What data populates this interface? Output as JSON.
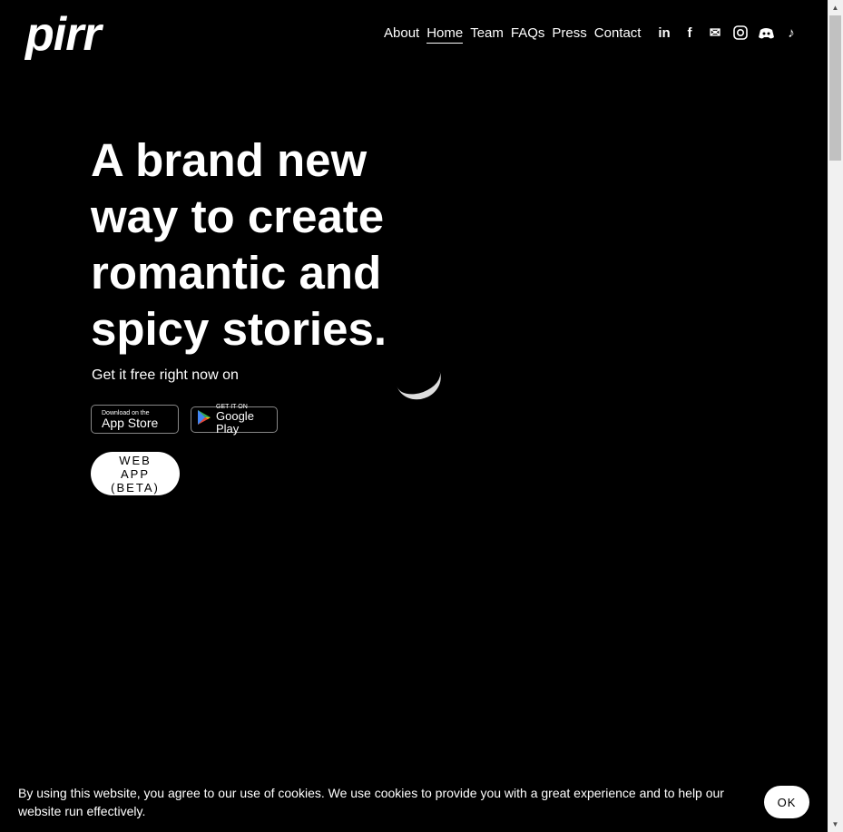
{
  "logo": "pirr",
  "nav": [
    "About",
    "Home",
    "Team",
    "FAQs",
    "Press",
    "Contact"
  ],
  "active_nav": "Home",
  "social": [
    "linkedin-icon",
    "facebook-icon",
    "email-icon",
    "instagram-icon",
    "discord-icon",
    "tiktok-icon"
  ],
  "hero": {
    "title": "A brand new way to create romantic and spicy stories.",
    "subtitle": "Get it free right now on"
  },
  "app_store": {
    "small": "Download on the",
    "big": "App Store"
  },
  "google_play": {
    "small": "GET IT ON",
    "big": "Google Play"
  },
  "web_app": {
    "line1": "WEB",
    "line2": "APP",
    "line3": "(BETA)"
  },
  "cookie": {
    "text": "By using this website, you agree to our use of cookies. We use cookies to provide you with a great experience and to help our website run effectively.",
    "ok": "OK"
  }
}
